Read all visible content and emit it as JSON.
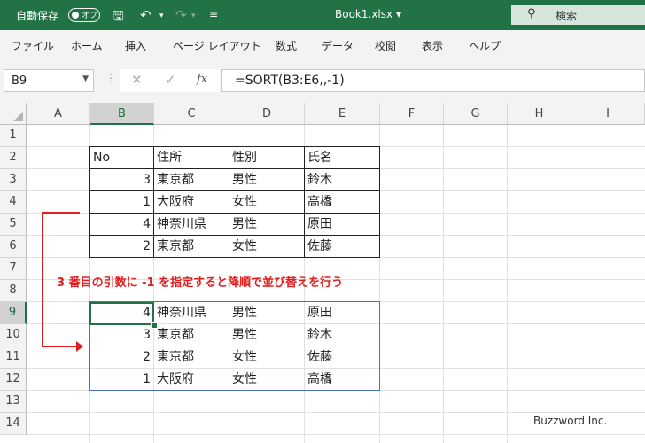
{
  "titlebar": {
    "autosave_label": "自動保存",
    "autosave_state": "オフ",
    "filename": "Book1.xlsx",
    "filename_caret": "▾",
    "search_label": "検索",
    "icons": [
      "save-icon",
      "undo-icon",
      "redo-icon",
      "customize-icon",
      "search-icon"
    ]
  },
  "ribbon": {
    "tabs": [
      "ファイル",
      "ホーム",
      "挿入",
      "ページ レイアウト",
      "数式",
      "データ",
      "校閲",
      "表示",
      "ヘルプ"
    ]
  },
  "formula_bar": {
    "name_box": "B9",
    "cancel": "✕",
    "enter": "✓",
    "fx": "fx",
    "formula": "=SORT(B3:E6,,-1)"
  },
  "grid": {
    "columns": [
      "A",
      "B",
      "C",
      "D",
      "E",
      "F",
      "G",
      "H",
      "I"
    ],
    "rows": [
      "1",
      "2",
      "3",
      "4",
      "5",
      "6",
      "7",
      "8",
      "9",
      "10",
      "11",
      "12",
      "13",
      "14"
    ],
    "selected_column": "B",
    "selected_row": "9"
  },
  "source_table": {
    "headers": [
      "No",
      "住所",
      "性別",
      "氏名"
    ],
    "rows": [
      [
        "3",
        "東京都",
        "男性",
        "鈴木"
      ],
      [
        "1",
        "大阪府",
        "女性",
        "高橋"
      ],
      [
        "4",
        "神奈川県",
        "男性",
        "原田"
      ],
      [
        "2",
        "東京都",
        "女性",
        "佐藤"
      ]
    ]
  },
  "result_table": {
    "rows": [
      [
        "4",
        "神奈川県",
        "男性",
        "原田"
      ],
      [
        "3",
        "東京都",
        "男性",
        "鈴木"
      ],
      [
        "2",
        "東京都",
        "女性",
        "佐藤"
      ],
      [
        "1",
        "大阪府",
        "女性",
        "高橋"
      ]
    ]
  },
  "annotation": "3 番目の引数に -1 を指定すると降順で並び替えを行う",
  "credit": "Buzzword Inc.",
  "colors": {
    "title_bar": "#217346",
    "annotation": "#e02020",
    "result_border": "#4472c4"
  }
}
